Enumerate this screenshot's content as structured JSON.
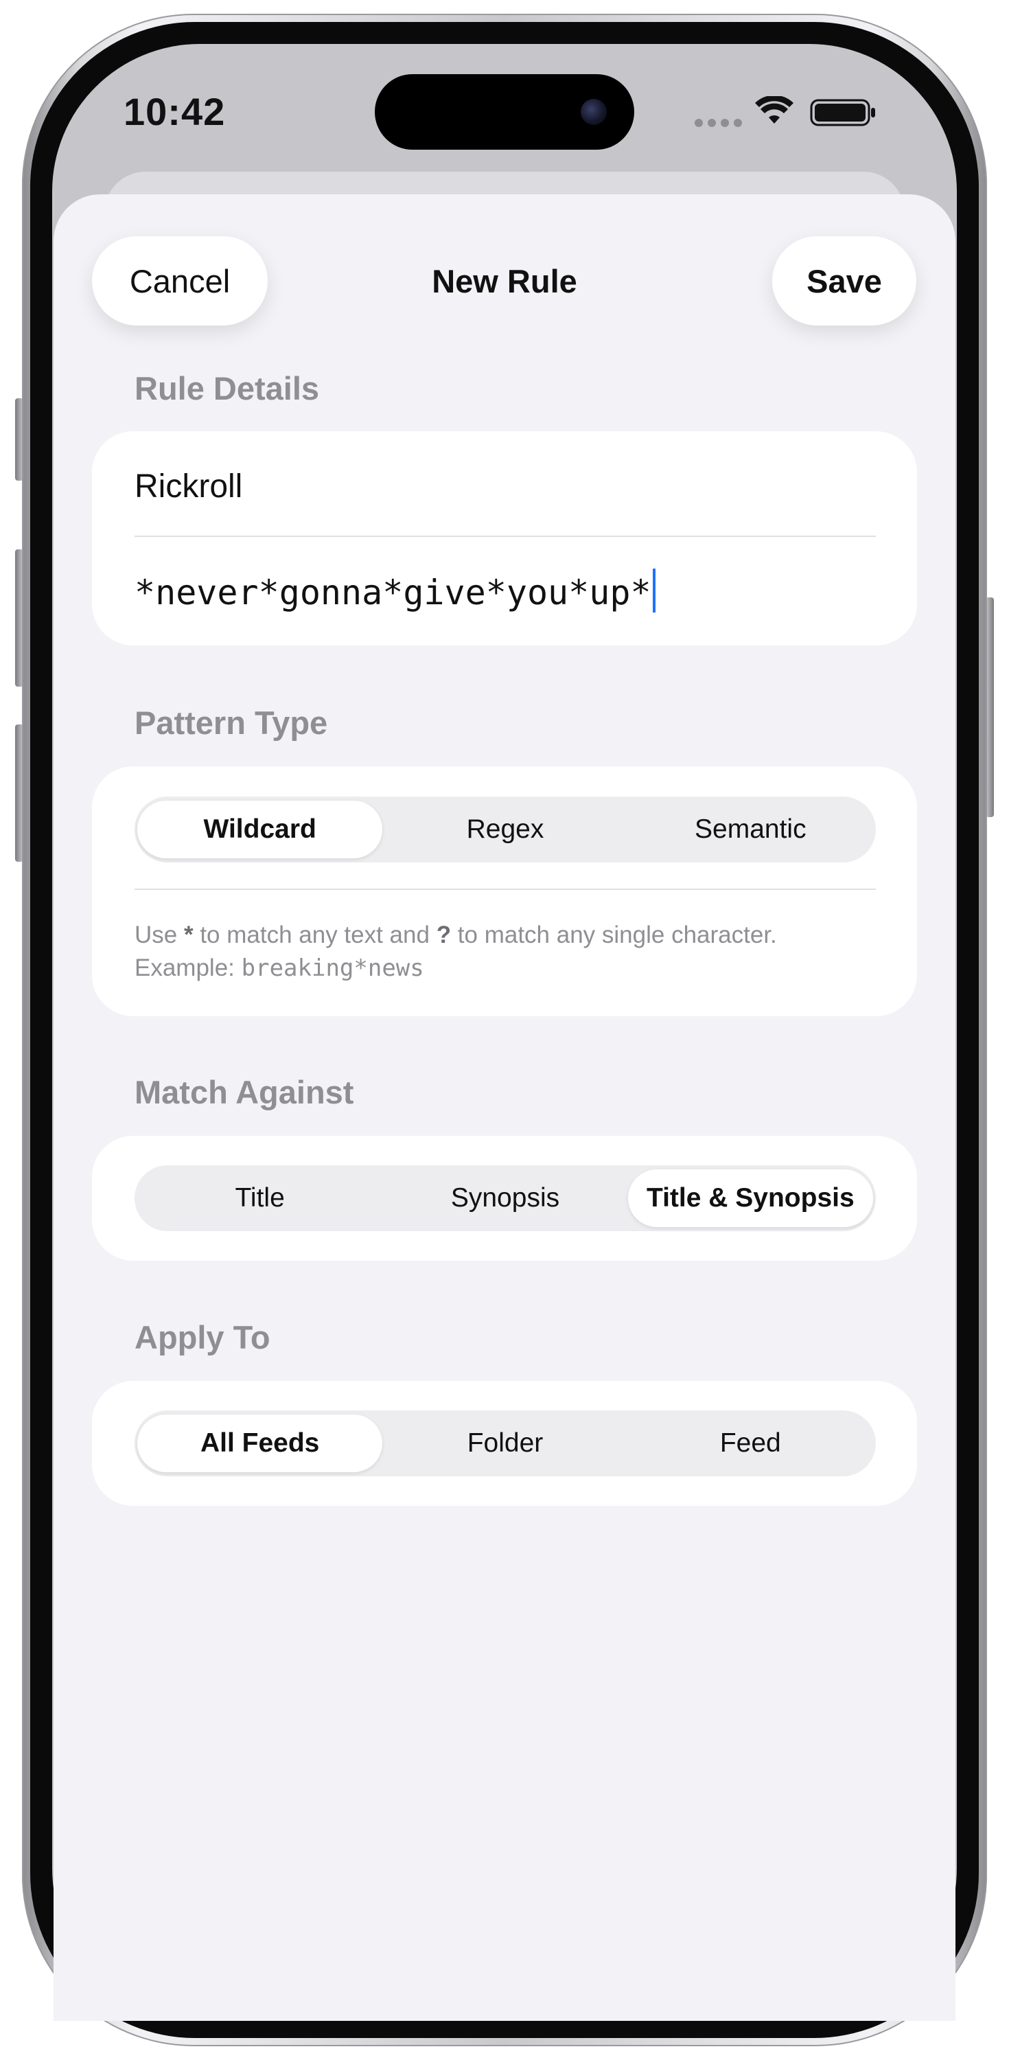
{
  "status_bar": {
    "time": "10:42",
    "icons": [
      "cellular-icon",
      "wifi-icon",
      "battery-icon"
    ]
  },
  "nav": {
    "cancel_label": "Cancel",
    "title": "New Rule",
    "save_label": "Save"
  },
  "rule_details": {
    "header": "Rule Details",
    "name_value": "Rickroll",
    "pattern_value": "*never*gonna*give*you*up*"
  },
  "pattern_type": {
    "header": "Pattern Type",
    "options": [
      "Wildcard",
      "Regex",
      "Semantic"
    ],
    "selected": "Wildcard",
    "hint": {
      "part1": "Use ",
      "star": "*",
      "part2": " to match any text and ",
      "question": "?",
      "part3": " to match any single character.",
      "example_label": "Example: ",
      "example_value": "breaking*news"
    }
  },
  "match_against": {
    "header": "Match Against",
    "options": [
      "Title",
      "Synopsis",
      "Title & Synopsis"
    ],
    "selected": "Title & Synopsis"
  },
  "apply_to": {
    "header": "Apply To",
    "options": [
      "All Feeds",
      "Folder",
      "Feed"
    ],
    "selected": "All Feeds"
  },
  "colors": {
    "sheet_background": "#f2f2f7",
    "card_background": "#ffffff",
    "section_header": "#8e8e93",
    "caret": "#1a73ff"
  }
}
